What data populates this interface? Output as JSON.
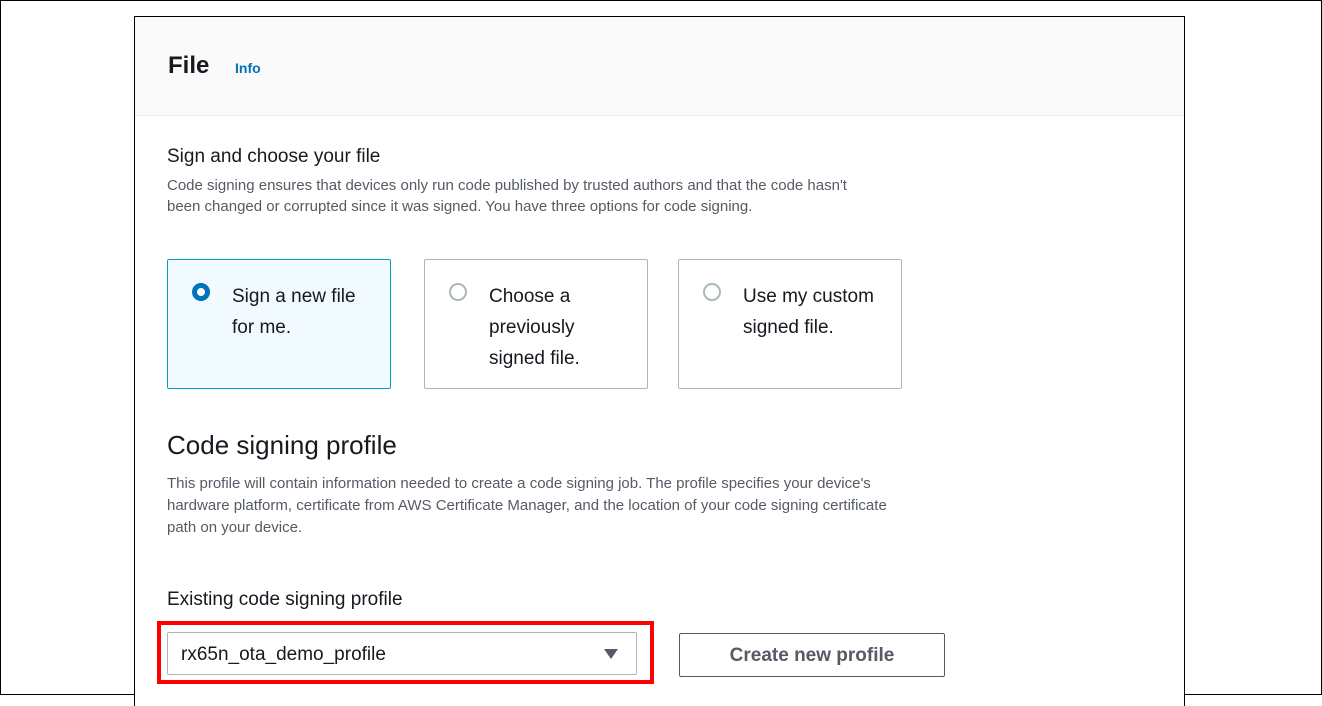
{
  "panel": {
    "title": "File",
    "info_link": "Info"
  },
  "sign_section": {
    "title": "Sign and choose your file",
    "description": "Code signing ensures that devices only run code published by trusted authors and that the code hasn't been changed or corrupted since it was signed. You have three options for code signing.",
    "options": [
      {
        "label": "Sign a new file for me.",
        "selected": true
      },
      {
        "label": "Choose a previously signed file.",
        "selected": false
      },
      {
        "label": "Use my custom signed file.",
        "selected": false
      }
    ]
  },
  "profile_section": {
    "title": "Code signing profile",
    "description": "This profile will contain information needed to create a code signing job. The profile specifies your device's hardware platform, certificate from AWS Certificate Manager, and the location of your code signing certificate path on your device.",
    "field_label": "Existing code signing profile",
    "selected_profile": "rx65n_ota_demo_profile",
    "create_button": "Create new profile"
  },
  "colors": {
    "accent": "#0073bb",
    "selected_tile_bg": "#f1faff",
    "highlight": "#ff0000"
  }
}
